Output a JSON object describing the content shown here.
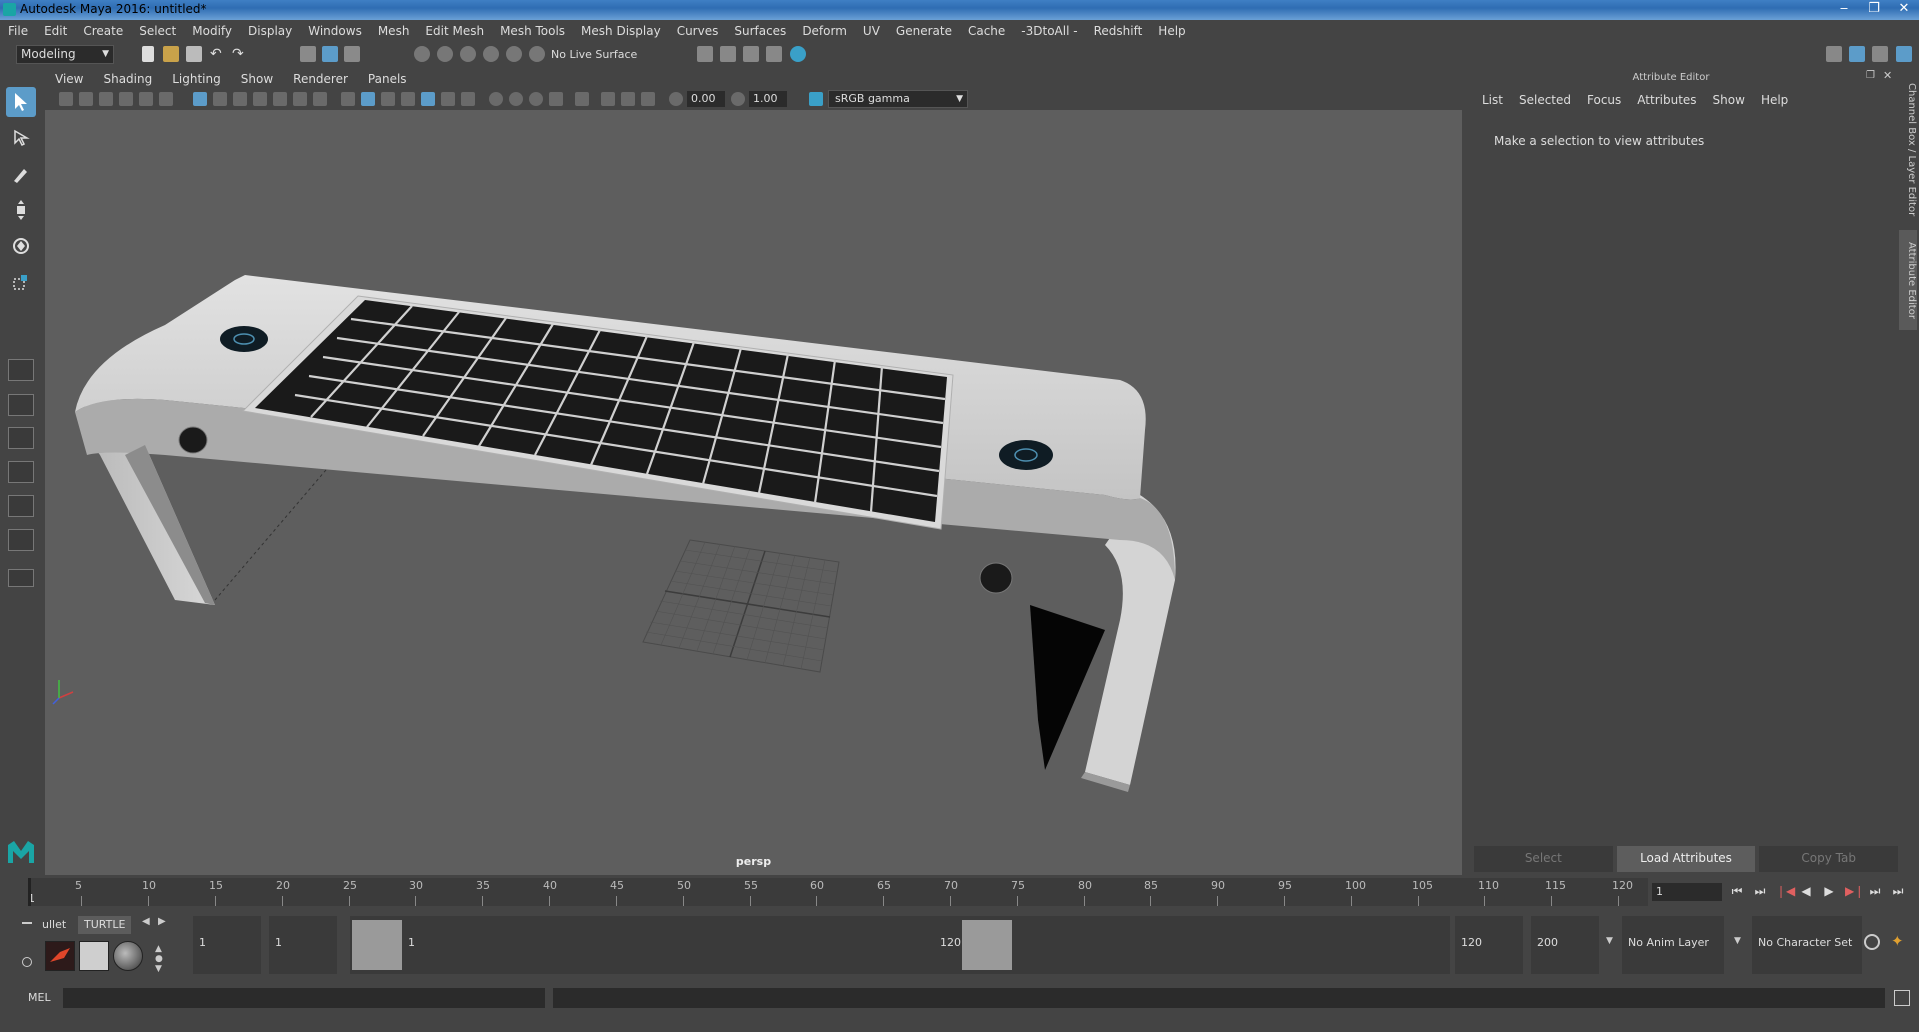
{
  "window": {
    "title": "Autodesk Maya 2016: untitled*",
    "controls": [
      "‒",
      "❐",
      "✕"
    ]
  },
  "menubar": [
    "File",
    "Edit",
    "Create",
    "Select",
    "Modify",
    "Display",
    "Windows",
    "Mesh",
    "Edit Mesh",
    "Mesh Tools",
    "Mesh Display",
    "Curves",
    "Surfaces",
    "Deform",
    "UV",
    "Generate",
    "Cache",
    "-3DtoAll -",
    "Redshift",
    "Help"
  ],
  "statusline": {
    "mode": "Modeling",
    "live_surface": "No Live Surface"
  },
  "viewport": {
    "menus": [
      "View",
      "Shading",
      "Lighting",
      "Show",
      "Renderer",
      "Panels"
    ],
    "exposure": "0.00",
    "gamma_value": "1.00",
    "color_space": "sRGB gamma",
    "camera_label": "persp"
  },
  "attribute_editor": {
    "header": "Attribute Editor",
    "tabs": [
      "List",
      "Selected",
      "Focus",
      "Attributes",
      "Show",
      "Help"
    ],
    "message": "Make a selection to view attributes",
    "buttons": [
      "Select",
      "Load Attributes",
      "Copy Tab"
    ],
    "side_tabs": [
      "Channel Box / Layer Editor",
      "Attribute Editor"
    ]
  },
  "timeline": {
    "ticks": [
      "5",
      "10",
      "15",
      "20",
      "25",
      "30",
      "35",
      "40",
      "45",
      "50",
      "55",
      "60",
      "65",
      "70",
      "75",
      "80",
      "85",
      "90",
      "95",
      "100",
      "105",
      "110",
      "115",
      "120"
    ],
    "start_tick": "1",
    "current_frame": "1"
  },
  "range": {
    "shelf_tabs": [
      "ullet",
      "TURTLE"
    ],
    "start_time": "1",
    "playback_start": "1",
    "slider_start_label": "1",
    "slider_end_label": "120",
    "playback_end": "120",
    "end_time": "200",
    "anim_layer": "No Anim Layer",
    "character_set": "No Character Set"
  },
  "command_line": {
    "label": "MEL"
  },
  "colors": {
    "accent": "#5c9cc9",
    "panel": "#444444",
    "viewport_bg": "#5e5e5e"
  }
}
